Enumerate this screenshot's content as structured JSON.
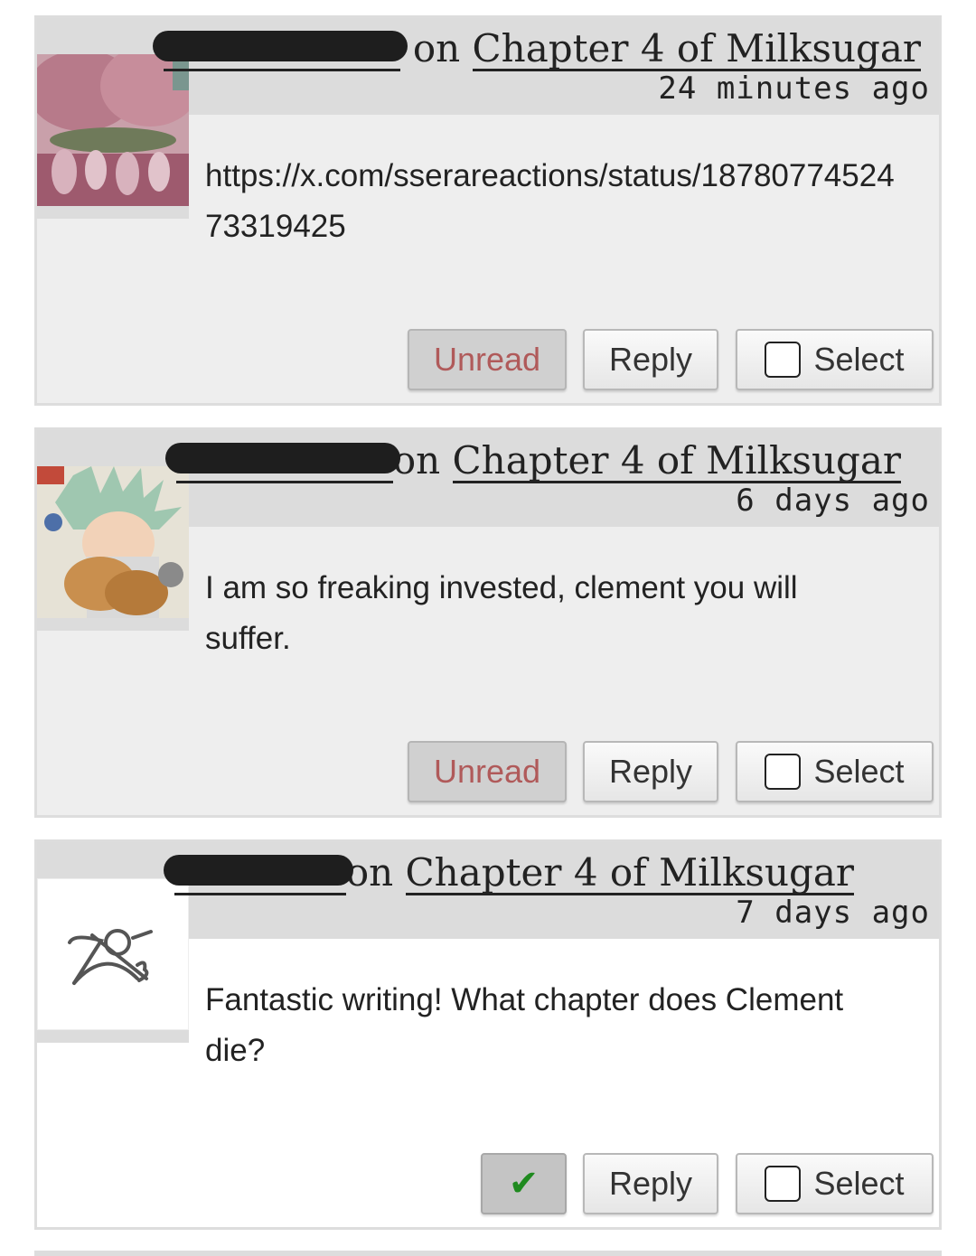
{
  "comments": [
    {
      "username": "redacted_user_1",
      "on_word": "on",
      "chapter_link": "Chapter 4 of Milksugar",
      "time": "24 minutes ago",
      "body": "https://x.com/sserareactions/status/1878077452473319425",
      "status_button": "Unread",
      "reply_label": "Reply",
      "select_label": "Select"
    },
    {
      "username": "redacted_user_2",
      "on_word": "on",
      "chapter_link": "Chapter 4 of Milksugar",
      "time": "6 days ago",
      "body": "I am so freaking invested, clement you will suffer.",
      "status_button": "Unread",
      "reply_label": "Reply",
      "select_label": "Select"
    },
    {
      "username": "redacted_user_3",
      "on_word": "on",
      "chapter_link": "Chapter 4 of Milksugar",
      "time": "7 days ago",
      "body": "Fantastic writing! What chapter does Clement die?",
      "status_button": "✔",
      "reply_label": "Reply",
      "select_label": "Select"
    }
  ],
  "icons": {
    "avatar_1": "pink-flower-avatar-icon",
    "avatar_2": "anime-character-avatar-icon",
    "avatar_3": "default-anonymous-avatar-icon",
    "read_check": "checkmark-icon",
    "select_box": "checkbox-icon"
  },
  "colors": {
    "header_bg": "#dcdcdc",
    "unread_text": "#b05a5a",
    "check_green": "#1f8a1f"
  }
}
